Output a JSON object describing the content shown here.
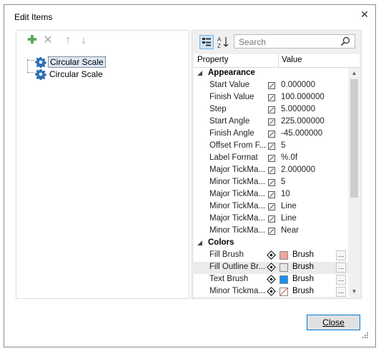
{
  "window": {
    "title": "Edit Items",
    "close_glyph": "✕"
  },
  "tree": {
    "toolbar": [
      {
        "name": "add-icon",
        "glyph": "✚",
        "color": "#58a55c"
      },
      {
        "name": "delete-icon",
        "glyph": "✕",
        "color": "#a8a8a8"
      },
      {
        "name": "move-up-icon",
        "glyph": "↑",
        "color": "#a8a8a8"
      },
      {
        "name": "move-down-icon",
        "glyph": "↓",
        "color": "#a8a8a8"
      }
    ],
    "items": [
      {
        "label": "Circular Scale",
        "selected": true
      },
      {
        "label": "Circular Scale",
        "selected": false
      }
    ]
  },
  "properties": {
    "search_placeholder": "Search",
    "columns": {
      "property": "Property",
      "value": "Value"
    },
    "categories": [
      {
        "name": "Appearance",
        "rows": [
          {
            "name": "Start Value",
            "value": "0.000000"
          },
          {
            "name": "Finish Value",
            "value": "100.000000"
          },
          {
            "name": "Step",
            "value": "5.000000"
          },
          {
            "name": "Start Angle",
            "value": "225.000000"
          },
          {
            "name": "Finish Angle",
            "value": "-45.000000"
          },
          {
            "name": "Offset From F...",
            "value": "5"
          },
          {
            "name": "Label Format",
            "value": "%.0f"
          },
          {
            "name": "Major TickMa...",
            "value": "2.000000"
          },
          {
            "name": "Minor TickMa...",
            "value": "5"
          },
          {
            "name": "Major TickMa...",
            "value": "10"
          },
          {
            "name": "Minor TickMa...",
            "value": "Line"
          },
          {
            "name": "Major TickMa...",
            "value": "Line"
          },
          {
            "name": "Minor TickMa...",
            "value": "Near"
          }
        ]
      },
      {
        "name": "Colors",
        "rows": [
          {
            "name": "Fill Brush",
            "value": "Brush",
            "swatch": "#f0a59a"
          },
          {
            "name": "Fill Outline Br...",
            "value": "Brush",
            "swatch": "#e6e6e6",
            "highlight": true
          },
          {
            "name": "Text Brush",
            "value": "Brush",
            "swatch": "#1e8ff0"
          },
          {
            "name": "Minor Tickma...",
            "value": "Brush",
            "swatch": "none"
          }
        ]
      }
    ]
  },
  "buttons": {
    "close": "Close"
  },
  "colors": {
    "accent": "#0078d7",
    "gear_blue": "#2f6fb7"
  }
}
